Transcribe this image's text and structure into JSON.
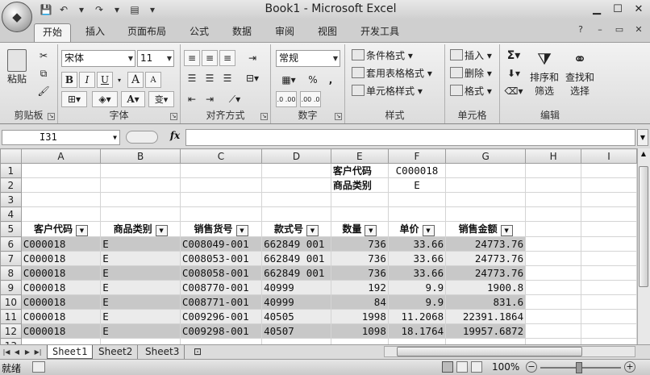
{
  "window": {
    "title": "Book1 - Microsoft Excel",
    "controls": {
      "minimize": "▁",
      "maximize": "☐",
      "close": "✕"
    }
  },
  "ribbon_tabs": [
    "开始",
    "插入",
    "页面布局",
    "公式",
    "数据",
    "审阅",
    "视图",
    "开发工具"
  ],
  "ribbon_right": {
    "help": "?",
    "min": "–",
    "restore": "▭",
    "close": "✕"
  },
  "groups": {
    "clipboard": {
      "label": "剪贴板",
      "paste": "粘贴"
    },
    "font": {
      "label": "字体",
      "font_name": "宋体",
      "font_size": "11",
      "bold": "B",
      "italic": "I",
      "underline": "U",
      "grow": "A",
      "shrink": "A",
      "fill": "◈",
      "color": "A",
      "wen": "变"
    },
    "alignment": {
      "label": "对齐方式"
    },
    "number": {
      "label": "数字",
      "format": "常规",
      "percent": "%",
      "comma": ",",
      "inc": ".0 .00",
      "dec": ".00 .0"
    },
    "styles": {
      "label": "样式",
      "cond": "条件格式",
      "table": "套用表格格式",
      "cell": "单元格样式"
    },
    "cells": {
      "label": "单元格",
      "insert": "插入",
      "delete": "删除",
      "format": "格式"
    },
    "editing": {
      "label": "编辑",
      "sum": "Σ",
      "sort": "排序和",
      "sort2": "筛选",
      "find": "查找和",
      "find2": "选择"
    }
  },
  "formula_bar": {
    "name_box": "I31",
    "fx": "fx",
    "value": ""
  },
  "columns": [
    "A",
    "B",
    "C",
    "D",
    "E",
    "F",
    "G",
    "H",
    "I"
  ],
  "rows": [
    "1",
    "2",
    "3",
    "4",
    "5",
    "6",
    "7",
    "8",
    "9",
    "10",
    "11",
    "12",
    "13"
  ],
  "criteria": {
    "r1": {
      "label": "客户代码",
      "value": "C000018"
    },
    "r2": {
      "label": "商品类别",
      "value": "E"
    }
  },
  "table_headers": [
    "客户代码",
    "商品类别",
    "销售货号",
    "款式号",
    "数量",
    "单价",
    "销售金额"
  ],
  "table_rows": [
    [
      "C000018",
      "E",
      "C008049-001",
      "662849 001",
      "736",
      "33.66",
      "24773.76"
    ],
    [
      "C000018",
      "E",
      "C008053-001",
      "662849 001",
      "736",
      "33.66",
      "24773.76"
    ],
    [
      "C000018",
      "E",
      "C008058-001",
      "662849 001",
      "736",
      "33.66",
      "24773.76"
    ],
    [
      "C000018",
      "E",
      "C008770-001",
      "40999",
      "192",
      "9.9",
      "1900.8"
    ],
    [
      "C000018",
      "E",
      "C008771-001",
      "40999",
      "84",
      "9.9",
      "831.6"
    ],
    [
      "C000018",
      "E",
      "C009296-001",
      "40505",
      "1998",
      "11.2068",
      "22391.1864"
    ],
    [
      "C000018",
      "E",
      "C009298-001",
      "40507",
      "1098",
      "18.1764",
      "19957.6872"
    ]
  ],
  "sheet_tabs": [
    "Sheet1",
    "Sheet2",
    "Sheet3"
  ],
  "status": {
    "ready": "就绪",
    "zoom": "100%"
  }
}
